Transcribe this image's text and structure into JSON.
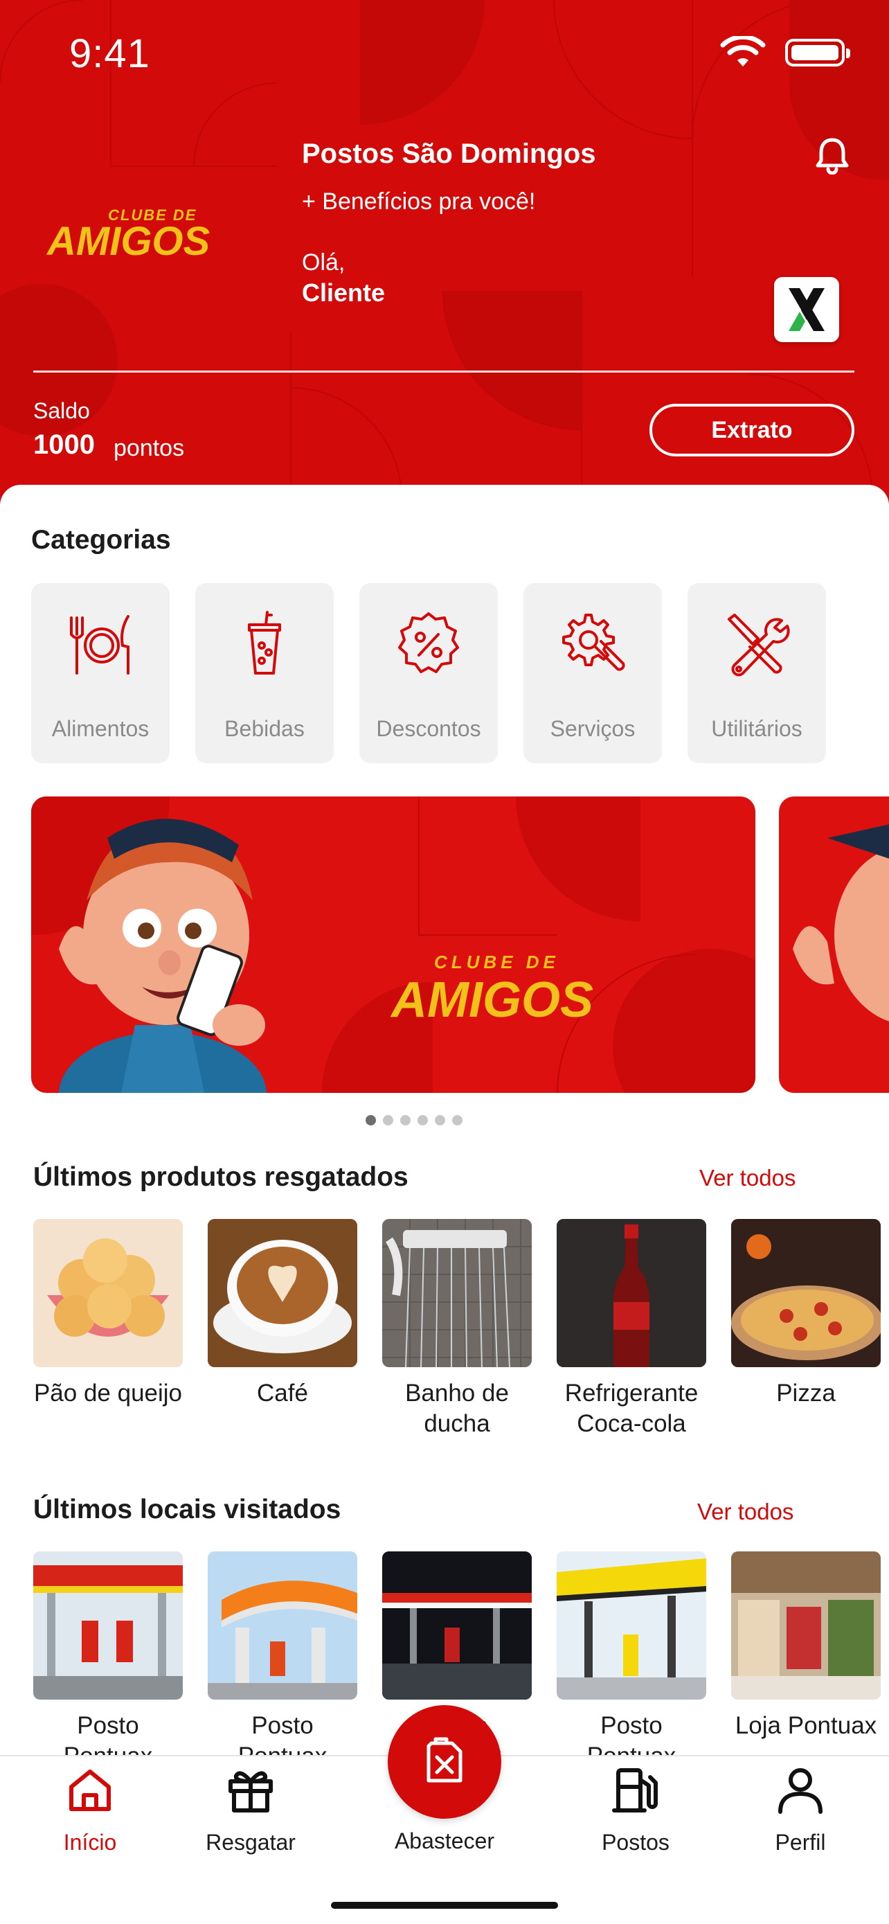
{
  "status_bar": {
    "time": "9:41"
  },
  "header": {
    "logo_text_top": "CLUBE DE",
    "logo_text_bottom": "AMIGOS",
    "title": "Postos São Domingos",
    "subtitle": "+ Benefícios pra você!",
    "greeting": "Olá,",
    "user_name": "Cliente",
    "badge_letter": "X",
    "balance_label": "Saldo",
    "balance_value": "1000",
    "balance_unit": "pontos",
    "statement_button": "Extrato"
  },
  "categories": {
    "title": "Categorias",
    "items": [
      {
        "label": "Alimentos",
        "icon": "plate-cutlery-icon"
      },
      {
        "label": "Bebidas",
        "icon": "drink-cup-icon"
      },
      {
        "label": "Descontos",
        "icon": "discount-badge-icon"
      },
      {
        "label": "Serviços",
        "icon": "gear-wrench-icon"
      },
      {
        "label": "Utilitários",
        "icon": "tools-icon"
      }
    ]
  },
  "banner": {
    "logo_text_top": "CLUBE DE",
    "logo_text_bottom": "AMIGOS",
    "slides_total": 6,
    "active_slide": 1
  },
  "redeemed": {
    "title": "Últimos produtos resgatados",
    "see_all": "Ver todos",
    "items": [
      {
        "label": "Pão de queijo"
      },
      {
        "label": "Café"
      },
      {
        "label": "Banho de ducha"
      },
      {
        "label": "Refrigerante Coca-cola"
      },
      {
        "label": "Pizza"
      }
    ]
  },
  "visited": {
    "title": "Últimos locais visitados",
    "see_all": "Ver todos",
    "items": [
      {
        "label": "Posto Pontuax"
      },
      {
        "label": "Posto Pontuax"
      },
      {
        "label": "Posto Pontuax"
      },
      {
        "label": "Posto Pontuax"
      },
      {
        "label": "Loja Pontuax"
      }
    ]
  },
  "tabbar": {
    "items": [
      {
        "label": "Início",
        "icon": "home-icon",
        "active": true
      },
      {
        "label": "Resgatar",
        "icon": "gift-icon"
      },
      {
        "label": "Abastecer",
        "icon": "fuel-can-icon"
      },
      {
        "label": "Postos",
        "icon": "gas-pump-icon"
      },
      {
        "label": "Perfil",
        "icon": "user-icon"
      }
    ]
  },
  "colors": {
    "brand_red": "#d20a0a",
    "gold": "#f2c21a",
    "muted_text": "#8a8a8a"
  }
}
